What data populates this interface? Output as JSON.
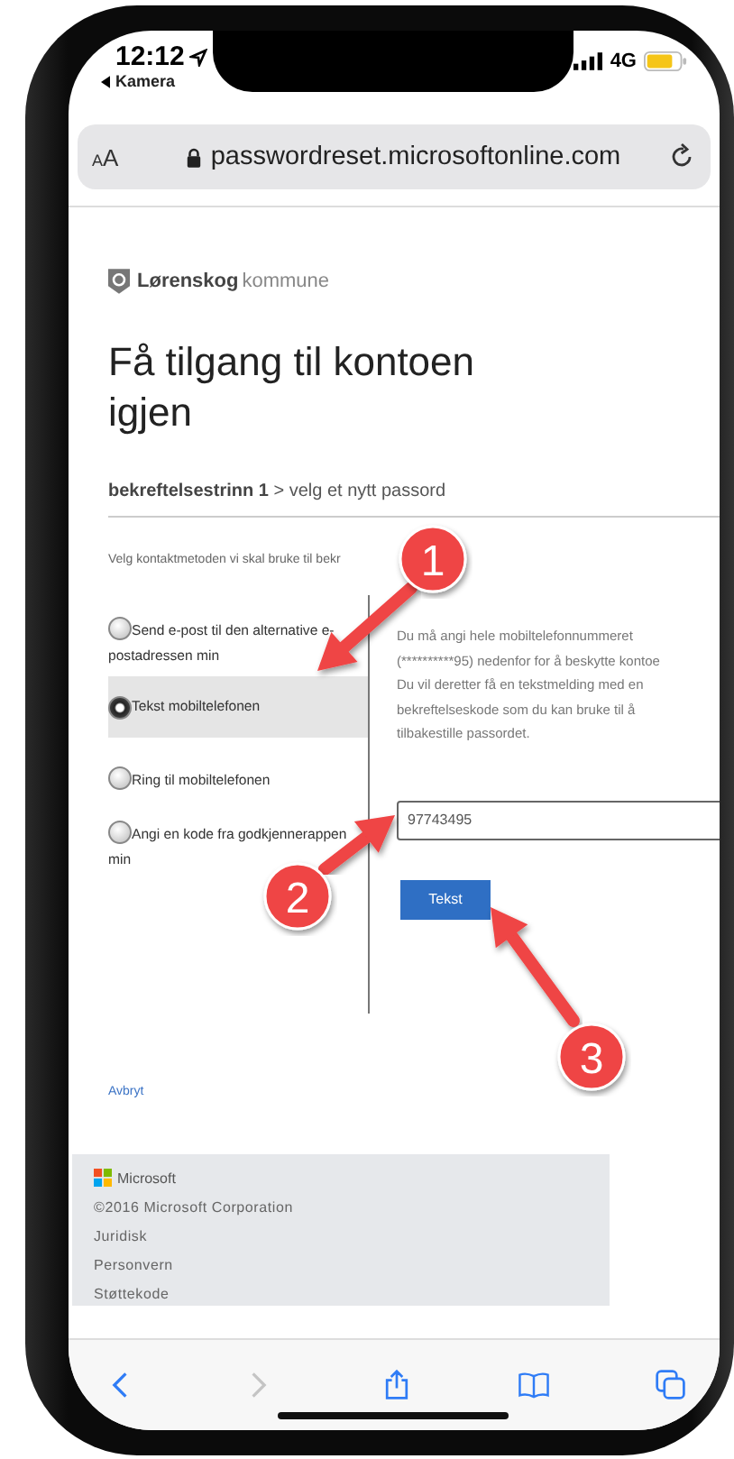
{
  "status_bar": {
    "time": "12:12",
    "back_app": "Kamera",
    "network": "4G"
  },
  "address_bar": {
    "text_size_button": "AA",
    "url": "passwordreset.microsoftonline.com"
  },
  "page": {
    "logo": {
      "name": "Lørenskog",
      "suffix": "kommune"
    },
    "title": "Få tilgang til kontoen igjen",
    "breadcrumb": "**bekreftelsestrinn 1** > velg et nytt passord",
    "instruction": "Velg kontaktmetoden vi skal bruke til bekr",
    "options": [
      {
        "label": "Send e-post til den alternative e-postadressen min",
        "selected": false
      },
      {
        "label": "Tekst mobiltelefonen",
        "selected": true
      },
      {
        "label": "Ring til mobiltelefonen",
        "selected": false
      },
      {
        "label": "Angi en kode fra godkjennerappen min",
        "selected": false
      }
    ],
    "description_lines": [
      "Du må angi hele mobiltelefonnummeret",
      "(**********95) nedenfor for å beskytte kontoe",
      "Du vil deretter få en tekstmelding med en",
      "bekreftelseskode som du kan bruke til å",
      "tilbakestille passordet."
    ],
    "phone_input": {
      "value": "97743495"
    },
    "submit_button": "Tekst",
    "cancel_link": "Avbryt",
    "footer": {
      "brand": "Microsoft",
      "copyright": "©2016 Microsoft Corporation",
      "links": [
        "Juridisk",
        "Personvern",
        "Støttekode"
      ]
    }
  },
  "toolbar": {
    "back_enabled": true,
    "forward_enabled": false
  },
  "annotations": [
    {
      "label": "1"
    },
    {
      "label": "2"
    },
    {
      "label": "3"
    }
  ]
}
